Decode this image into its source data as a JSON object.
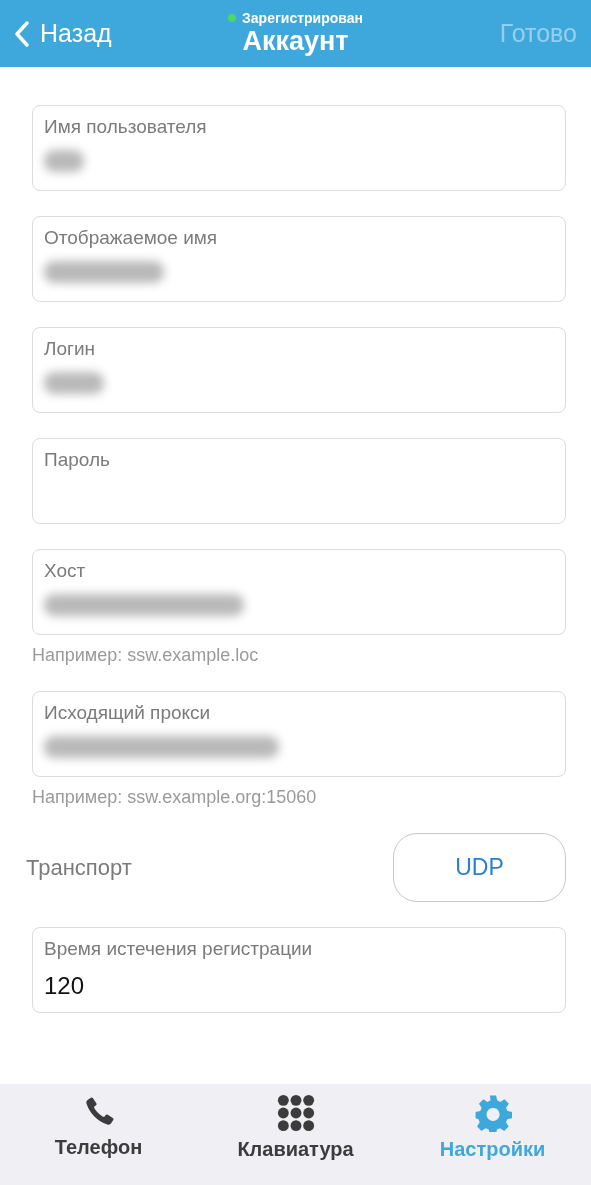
{
  "header": {
    "back_label": "Назад",
    "status": {
      "text": "Зарегистрирован",
      "color": "#4cd964"
    },
    "title": "Аккаунт",
    "done": {
      "label": "Готово",
      "disabled": true
    }
  },
  "fields": [
    {
      "kind": "input",
      "label": "Имя пользователя",
      "blurred": true
    },
    {
      "kind": "input",
      "label": "Отображаемое имя",
      "blurred": true
    },
    {
      "kind": "input",
      "label": "Логин",
      "blurred": true
    },
    {
      "kind": "input",
      "label": "Пароль",
      "blurred": false
    },
    {
      "kind": "input",
      "label": "Хост",
      "blurred": true,
      "hint": "Например: ssw.example.loc"
    },
    {
      "kind": "input",
      "label": "Исходящий прокси",
      "blurred": true,
      "hint": "Например: ssw.example.org:15060"
    },
    {
      "kind": "select",
      "label": "Транспорт",
      "value": "UDP"
    },
    {
      "kind": "input",
      "label": "Время истечения регистрации",
      "value": "120",
      "blurred": false
    }
  ],
  "tabs": [
    {
      "label": "Телефон",
      "kind": "phone",
      "selected": false
    },
    {
      "label": "Клавиатура",
      "kind": "keypad",
      "selected": false
    },
    {
      "label": "Настройки",
      "kind": "settings",
      "selected": true
    }
  ]
}
